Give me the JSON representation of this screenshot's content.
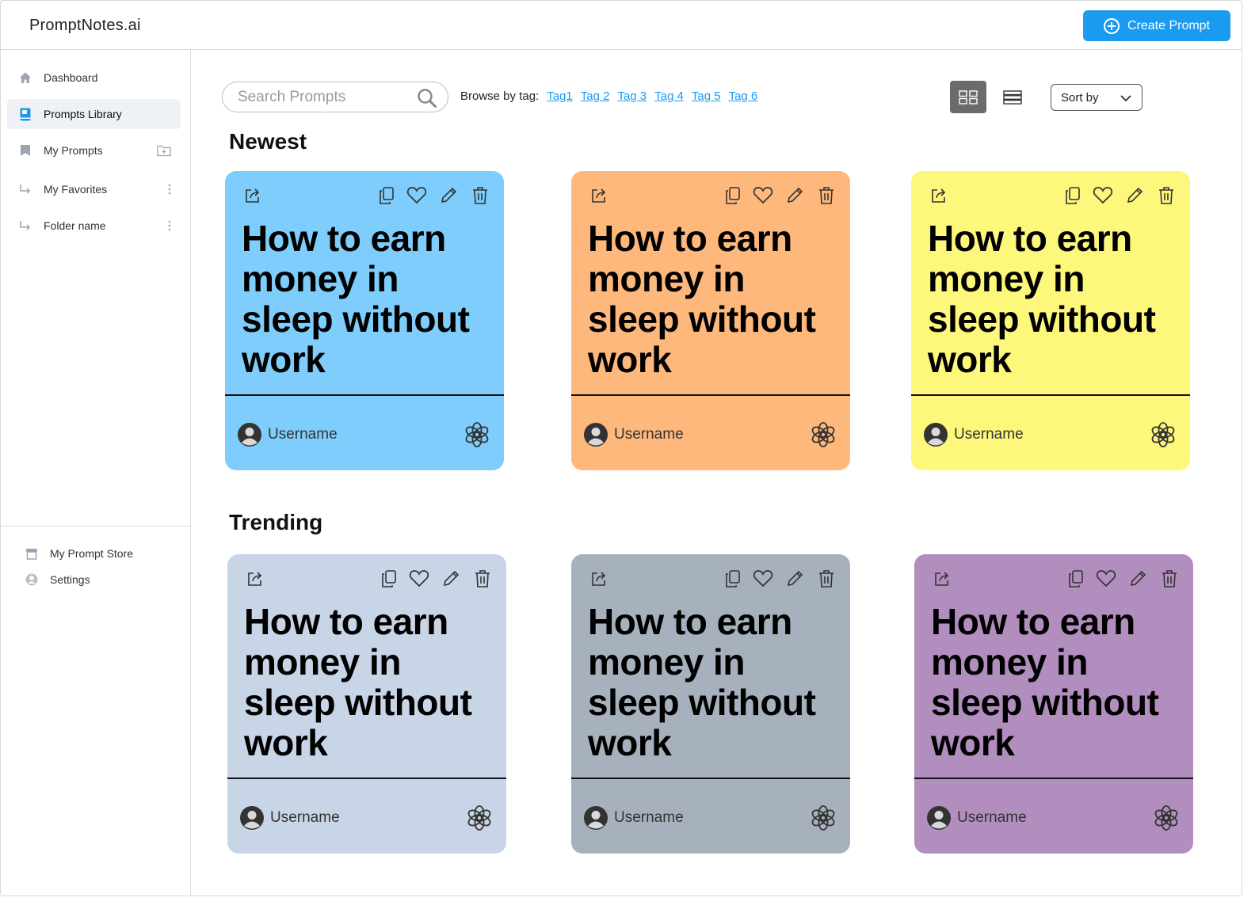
{
  "app": {
    "brand": "PromptNotes.ai",
    "create_button": "Create Prompt"
  },
  "sidebar": {
    "items": [
      {
        "label": "Dashboard",
        "icon": "home-icon"
      },
      {
        "label": "Prompts Library",
        "icon": "book-icon",
        "active": true
      },
      {
        "label": "My Prompts",
        "icon": "bookmark-icon",
        "trailing_icon": "folder-add-icon"
      },
      {
        "label": "My Favorites",
        "icon": "sub-arrow-icon",
        "trailing_icon": "more-vertical-icon"
      },
      {
        "label": "Folder name",
        "icon": "sub-arrow-icon",
        "trailing_icon": "more-vertical-icon"
      }
    ],
    "bottom_items": [
      {
        "label": "My Prompt Store",
        "icon": "store-icon"
      },
      {
        "label": "Settings",
        "icon": "user-circle-icon"
      }
    ]
  },
  "toolbar": {
    "search_placeholder": "Search Prompts",
    "browse_label": "Browse by tag:",
    "tags": [
      "Tag1",
      "Tag 2",
      "Tag 3",
      "Tag 4",
      "Tag 5",
      "Tag 6"
    ],
    "sort_label": "Sort by",
    "view_mode": "grid"
  },
  "sections": [
    {
      "title": "Newest",
      "cards": [
        {
          "title": "How to earn money in sleep without work",
          "username": "Username",
          "color": "#7ecdfc"
        },
        {
          "title": "How to earn money in sleep without work",
          "username": "Username",
          "color": "#ffb87c"
        },
        {
          "title": "How to earn money in sleep without work",
          "username": "Username",
          "color": "#fdf77c"
        }
      ]
    },
    {
      "title": "Trending",
      "cards": [
        {
          "title": "How to earn money in sleep without work",
          "username": "Username",
          "color": "#c8d5e6"
        },
        {
          "title": "How to earn money in sleep without work",
          "username": "Username",
          "color": "#a6b1bd"
        },
        {
          "title": "How to earn money in sleep without work",
          "username": "Username",
          "color": "#b18ebe"
        }
      ]
    }
  ],
  "colors": {
    "accent": "#1a9bf0",
    "active_sidebar_bg": "#eef1f5"
  }
}
